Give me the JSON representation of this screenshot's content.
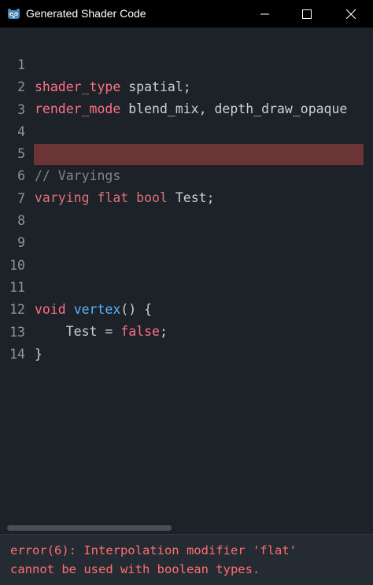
{
  "window": {
    "title": "Generated Shader Code",
    "icon": "godot-icon",
    "controls": [
      "minimize-icon",
      "maximize-icon",
      "close-icon"
    ]
  },
  "editor": {
    "line_numbers": [
      "1",
      "2",
      "3",
      "4",
      "5",
      "6",
      "7",
      "8",
      "9",
      "10",
      "11",
      "12",
      "13",
      "14"
    ],
    "highlighted_line": 6,
    "lines": {
      "l1": {
        "kw": "shader_type",
        "rest": " spatial;"
      },
      "l2": {
        "kw": "render_mode",
        "rest": " blend_mix, depth_draw_opaque"
      },
      "l5": {
        "comment": "// Varyings"
      },
      "l6": {
        "kw1": "varying",
        "kw2": "flat",
        "kw3": "bool",
        "rest": " Test;"
      },
      "l11": {
        "kw": "void",
        "fn": "vertex",
        "rest": "() {"
      },
      "l12": {
        "indent": "    ",
        "ident": "Test",
        "op": " = ",
        "kw": "false",
        "end": ";"
      },
      "l13": {
        "rest": "}"
      }
    }
  },
  "error": {
    "line1": "error(6): Interpolation modifier 'flat'",
    "line2": "cannot be used with boolean types."
  },
  "colors": {
    "background": "#1d2229",
    "highlight": "#6b3436",
    "keyword": "#ff7085",
    "function": "#57b3ff",
    "comment": "#7f8590",
    "error": "#ff6e6e"
  }
}
